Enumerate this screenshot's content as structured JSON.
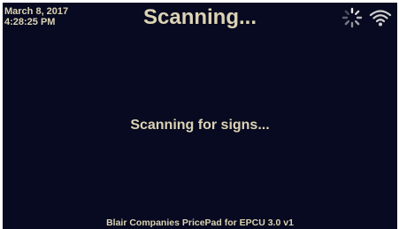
{
  "header": {
    "date": "March 8, 2017",
    "time": "4:28:25 PM",
    "title": "Scanning..."
  },
  "status": {
    "message": "Scanning for signs...",
    "busy_icon": "loading-spinner-icon",
    "connection_icon": "wifi-signal-icon"
  },
  "footer": {
    "text": "Blair Companies PricePad for EPCU 3.0 v1"
  },
  "colors": {
    "background": "#070a20",
    "text": "#dcd3b4",
    "icon": "#e8e8e8"
  }
}
